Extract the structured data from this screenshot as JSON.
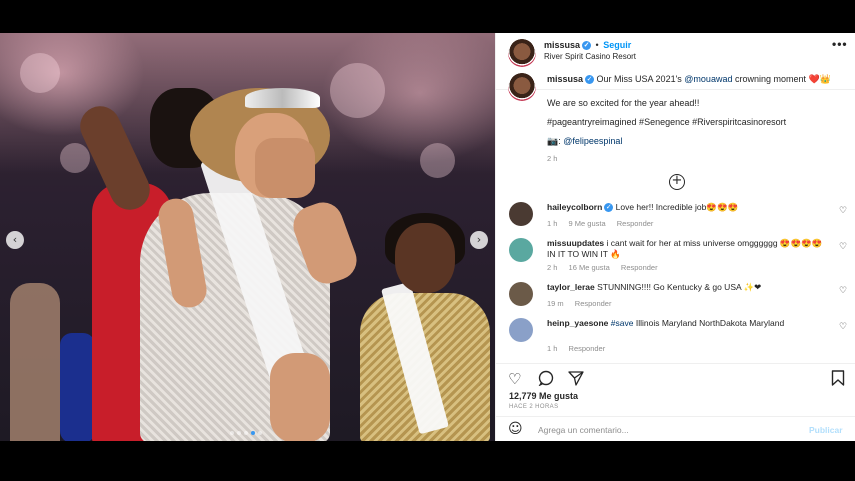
{
  "post": {
    "header": {
      "username": "missusa",
      "separator": "•",
      "follow_label": "Seguir",
      "location": "River Spirit Casino Resort",
      "more_icon": "more-options-icon"
    },
    "caption": {
      "username": "missusa",
      "text_before_mention": "Our Miss USA 2021's ",
      "mention": "@mouawad",
      "text_after_mention": " crowning moment ❤️👑",
      "line2": "We are so excited for the year ahead!!",
      "hashtags": "#pageantryreimagined #Senegence #Riverspiritcasinoresort",
      "credit_prefix": "📷: ",
      "credit_mention": "@felipeespinal",
      "time": "2 h"
    },
    "comments": [
      {
        "username": "haileycolborn",
        "verified": true,
        "text": "Love her!! Incredible job😍😍😍",
        "time": "1 h",
        "likes": "9 Me gusta",
        "reply": "Responder",
        "avatar_color": "#4a3a32"
      },
      {
        "username": "missuupdates",
        "verified": false,
        "text": "i cant wait for her at miss universe omgggggg 😍😍😍😍 IN IT TO WIN IT 🔥",
        "time": "2 h",
        "likes": "16 Me gusta",
        "reply": "Responder",
        "avatar_color": "#5aa8a0"
      },
      {
        "username": "taylor_lerae",
        "verified": false,
        "text": "STUNNING!!!! Go Kentucky & go USA ✨❤",
        "time": "19 m",
        "likes": "",
        "reply": "Responder",
        "avatar_color": "#6b5a48"
      },
      {
        "username": "heinp_yaesone",
        "verified": false,
        "mention": "#save",
        "text": " Illinois Maryland NorthDakota Maryland",
        "time": "1 h",
        "likes": "",
        "reply": "Responder",
        "avatar_color": "#8aa0c8"
      }
    ],
    "actions": {
      "like_icon": "heart-icon",
      "comment_icon": "comment-icon",
      "share_icon": "share-icon",
      "save_icon": "bookmark-icon",
      "likes_count": "12,779 Me gusta",
      "posted_ago": "HACE 2 HORAS"
    },
    "add_comment": {
      "placeholder": "Agrega un comentario...",
      "publish_label": "Publicar"
    },
    "carousel": {
      "prev_icon": "chevron-left-icon",
      "next_icon": "chevron-right-icon",
      "current_slide": 4,
      "total_slides": 5
    },
    "load_more_icon": "plus-circle-icon"
  }
}
